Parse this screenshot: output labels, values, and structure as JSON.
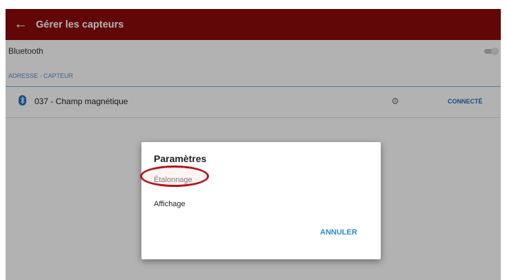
{
  "appbar": {
    "title": "Gérer les capteurs"
  },
  "bluetooth": {
    "label": "Bluetooth",
    "enabled": false
  },
  "section": {
    "label": "ADRESSE - CAPTEUR"
  },
  "device": {
    "name": "037 - Champ magnétique",
    "status": "CONNECTÉ"
  },
  "dialog": {
    "title": "Paramètres",
    "options": [
      "Étalonnage",
      "Affichage"
    ],
    "cancel_label": "ANNULER"
  },
  "colors": {
    "appbar": "#8b0b0b",
    "accent": "#2a88d8",
    "highlight": "#b5131b"
  }
}
